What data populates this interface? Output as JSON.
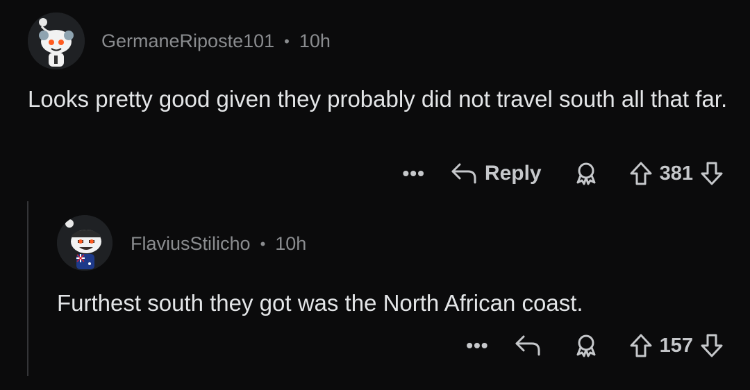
{
  "comments": [
    {
      "author": "GermaneRiposte101",
      "separator": "•",
      "age": "10h",
      "text": "Looks pretty good given they probably did not travel south all that far.",
      "more_label": "•••",
      "reply_label": "Reply",
      "score": "381",
      "avatar_icon": "snoo-avatar-icon"
    },
    {
      "author": "FlaviusStilicho",
      "separator": "•",
      "age": "10h",
      "text": "Furthest south they got was the North African coast.",
      "more_label": "•••",
      "score": "157",
      "avatar_icon": "snoo-avatar-icon"
    }
  ],
  "colors": {
    "background": "#0b0b0c",
    "meta_text": "#8a8c8f",
    "body_text": "#e3e5e7",
    "action_text": "#c6c8cb",
    "thread_line": "#343538"
  }
}
